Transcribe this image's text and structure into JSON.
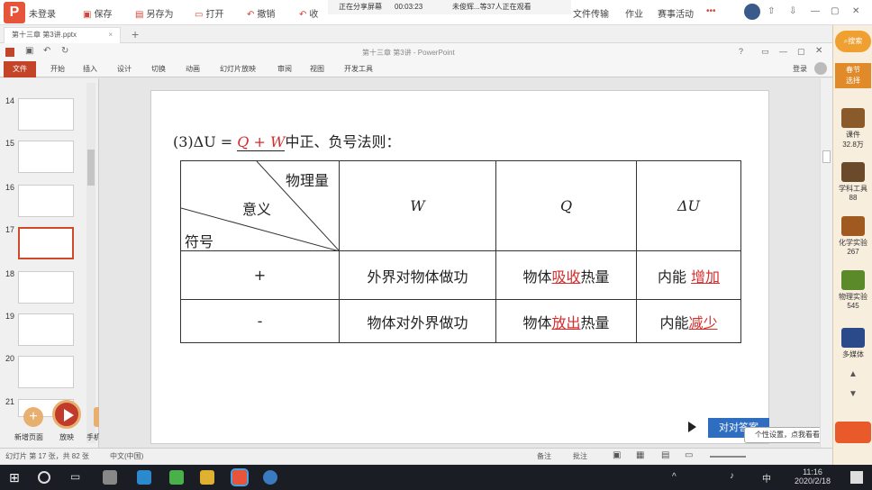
{
  "topbar": {
    "login": "未登录",
    "save": "保存",
    "saveas": "另存为",
    "open": "打开",
    "undo": "撤销",
    "undo2": "收",
    "file_transfer": "文件传输",
    "homework": "作业",
    "events": "赛事活动",
    "more": "•••"
  },
  "share": {
    "status": "正在分享屏幕",
    "timer": "00:03:23",
    "viewers": "未俊辉...等37人正在观看"
  },
  "tab": {
    "title": "第十三章 第3讲.pptx",
    "close": "×",
    "add": "+"
  },
  "ppt": {
    "title": "第十三章 第3讲 - PowerPoint",
    "help": "?",
    "login": "登录"
  },
  "ribbon": {
    "file": "文件",
    "tabs": [
      "开始",
      "插入",
      "设计",
      "切换",
      "动画",
      "幻灯片放映",
      "审阅",
      "视图",
      "开发工具"
    ]
  },
  "thumbs": [
    "14",
    "15",
    "16",
    "17",
    "18",
    "19",
    "20",
    "21"
  ],
  "slide": {
    "prefix": "(3)ΔU =",
    "blank": "Q + W",
    "suffix": "中正、负号法则：",
    "hdr": {
      "physical": "物理量",
      "meaning": "意义",
      "sign": "符号",
      "W": "W",
      "Q": "Q",
      "dU": "ΔU"
    },
    "row1": {
      "sign": "+",
      "w": "外界对物体做功",
      "q_pre": "物体",
      "q_ans": "吸收",
      "q_post": "热量",
      "u_pre": "内能",
      "u_ans": "增加"
    },
    "row2": {
      "sign": "-",
      "w": "物体对外界做功",
      "q_pre": "物体",
      "q_ans": "放出",
      "q_post": "热量",
      "u_pre": "内能",
      "u_ans": "减少"
    }
  },
  "floatbar": {
    "new": "新增页面",
    "play": "放映",
    "mobile": "手机遥控"
  },
  "answer_button": "对对答案",
  "tooltip": "个性设置，点我看看",
  "status": {
    "slide": "幻灯片 第 17 张，共 82 张",
    "lang": "中文(中国)",
    "notes": "备注",
    "comments": "批注"
  },
  "right": {
    "search": "搜索",
    "festival": "春节\n选择",
    "courseware": "课件",
    "courseware_n": "32.8万",
    "tools": "学科工具",
    "tools_n": "88",
    "chem": "化学实验",
    "chem_n": "267",
    "phys": "物理实验",
    "phys_n": "545",
    "media": "多媒体"
  },
  "taskbar": {
    "time": "11:16",
    "date": "2020/2/18",
    "ime": "中",
    "ime2": "中"
  }
}
